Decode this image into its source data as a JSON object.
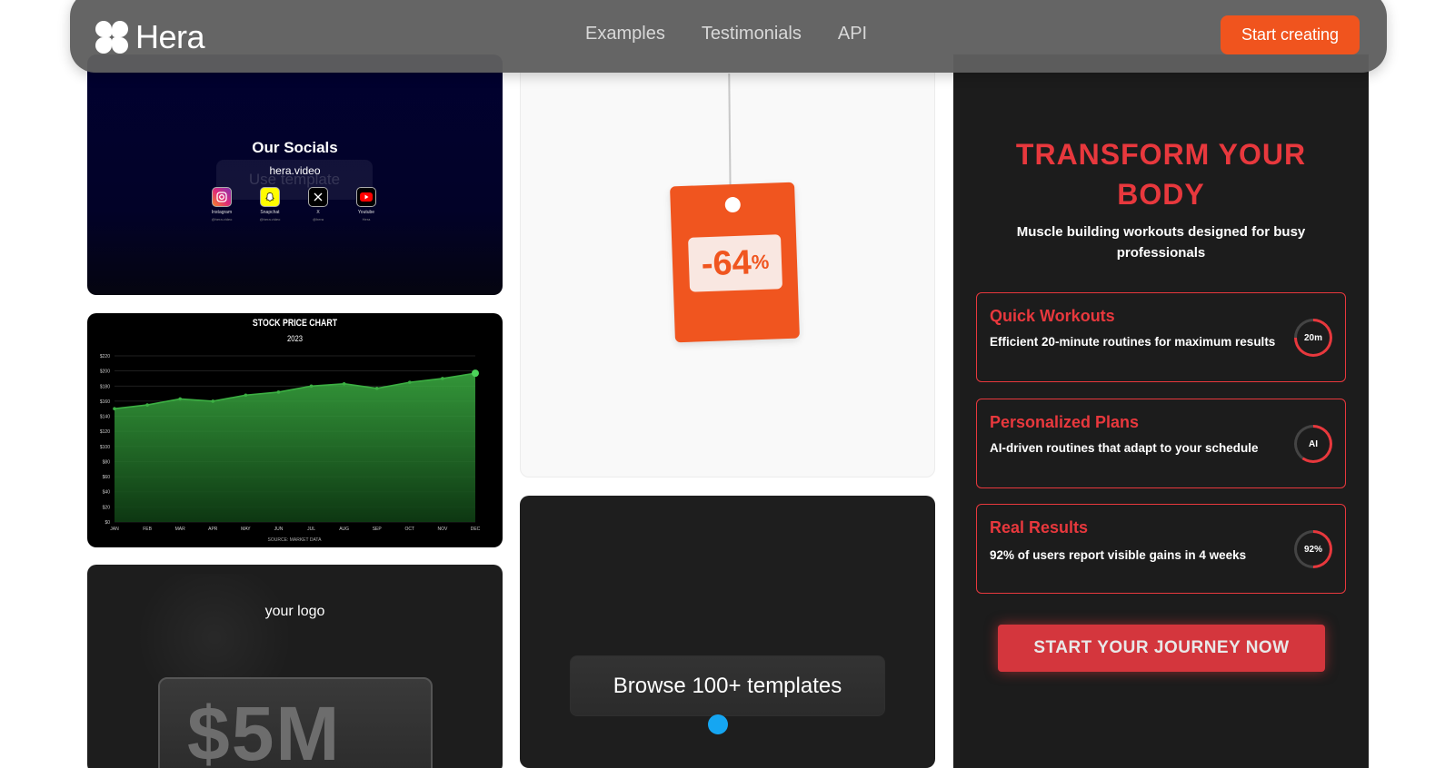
{
  "nav": {
    "brand": "Hera",
    "links": [
      "Examples",
      "Testimonials",
      "API"
    ],
    "cta": "Start creating"
  },
  "socials_card": {
    "title": "Our Socials",
    "url": "hera.video",
    "overlay_button": "Use template",
    "items": [
      {
        "name": "Instagram",
        "handle": "@hera.video",
        "icon": "instagram-icon",
        "color": "#e1306c"
      },
      {
        "name": "Snapchat",
        "handle": "@hera.video",
        "icon": "snapchat-icon",
        "color": "#fffc00"
      },
      {
        "name": "X",
        "handle": "@hera",
        "icon": "x-icon",
        "color": "#000000"
      },
      {
        "name": "Youtube",
        "handle": "Hera",
        "icon": "youtube-icon",
        "color": "#ff0000"
      }
    ]
  },
  "stock_card": {
    "footer": "SOURCE: MARKET DATA"
  },
  "chart_data": {
    "type": "area",
    "title": "STOCK PRICE CHART",
    "subtitle": "2023",
    "categories": [
      "JAN",
      "FEB",
      "MAR",
      "APR",
      "MAY",
      "JUN",
      "JUL",
      "AUG",
      "SEP",
      "OCT",
      "NOV",
      "DEC"
    ],
    "y_ticks": [
      "$0",
      "$20",
      "$40",
      "$60",
      "$80",
      "$100",
      "$120",
      "$140",
      "$160",
      "$180",
      "$200",
      "$220"
    ],
    "ylim": [
      0,
      220
    ],
    "values": [
      150,
      155,
      163,
      160,
      168,
      172,
      180,
      183,
      177,
      185,
      190,
      197
    ],
    "color": "#3cb043",
    "grid": true
  },
  "logo_card": {
    "logo_text": "your logo",
    "amount": "$5M"
  },
  "sale_card": {
    "discount_number": "-64",
    "discount_symbol": "%",
    "tag_color": "#f0551f"
  },
  "browse_card": {
    "button": "Browse 100+ templates"
  },
  "fitness_card": {
    "title_line1": "TRANSFORM YOUR",
    "title_line2": "BODY",
    "subtitle": "Muscle building workouts designed for busy professionals",
    "features": [
      {
        "title": "Quick Workouts",
        "desc": "Efficient 20-minute routines for maximum results",
        "badge": "20m",
        "progress": 0.75
      },
      {
        "title": "Personalized Plans",
        "desc": "AI-driven routines that adapt to your schedule",
        "badge": "AI",
        "progress": 0.6
      },
      {
        "title": "Real Results",
        "desc": "92% of users report visible gains in 4 weeks",
        "badge": "92%",
        "progress": 0.5
      }
    ],
    "cta": "START YOUR JOURNEY NOW",
    "accent": "#e8383d"
  }
}
